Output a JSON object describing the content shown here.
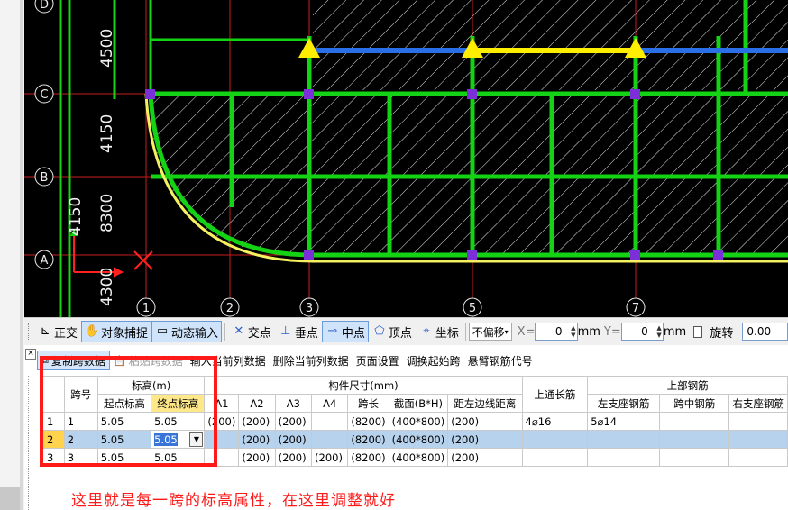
{
  "cad_view": {
    "axis_labels": [
      "D",
      "C",
      "B",
      "A",
      "1",
      "2",
      "3",
      "5",
      "7"
    ],
    "dimensions": [
      "4500",
      "4150",
      "8300",
      "4150",
      "4150",
      "4300"
    ]
  },
  "toolbar": {
    "items": [
      {
        "label": "正交",
        "icon": "ortho-icon"
      },
      {
        "label": "对象捕捉",
        "icon": "object-snap-icon"
      },
      {
        "label": "动态输入",
        "icon": "dynamic-input-icon"
      },
      {
        "label": "交点",
        "icon": "intersection-icon"
      },
      {
        "label": "垂点",
        "icon": "perpendicular-icon"
      },
      {
        "label": "中点",
        "icon": "midpoint-icon"
      },
      {
        "label": "顶点",
        "icon": "vertex-icon"
      },
      {
        "label": "坐标",
        "icon": "coordinate-icon"
      }
    ],
    "offset_select": "不偏移",
    "x_label": "X=",
    "x_value": "0",
    "y_label": "Y=",
    "y_value": "0",
    "unit": "mm",
    "rotate_label": "旋转",
    "rotate_value": "0.00"
  },
  "panel_toolbar": {
    "copy_span": "复制跨数据",
    "paste_span": "粘贴跨数据",
    "input": "输入当前列数据",
    "delete": "删除当前列数据",
    "page_setup": "页面设置",
    "swap": "调换起始跨",
    "cantilever": "悬臂钢筋代号"
  },
  "table": {
    "header": {
      "span_no": "跨号",
      "elevation": "标高(m)",
      "start_elev": "起点标高",
      "end_elev": "终点标高",
      "member_size": "构件尺寸(mm)",
      "a1": "A1",
      "a2": "A2",
      "a3": "A3",
      "a4": "A4",
      "span_len": "跨长",
      "section": "截面(B*H)",
      "left_dist": "距左边线距离",
      "top_long_bar": "上通长筋",
      "top_rebar": "上部钢筋",
      "left_support": "左支座钢筋",
      "mid_span": "跨中钢筋",
      "right_support": "右支座钢筋"
    },
    "rows": [
      {
        "rn": "1",
        "span": "1",
        "start": "5.05",
        "end": "5.05",
        "a1": "(200)",
        "a2": "(200)",
        "a3": "(200)",
        "a4": "",
        "len": "(8200)",
        "sec": "(400*800)",
        "dist": "(200)",
        "long": "4⌀16",
        "left": "5⌀14",
        "mid": "",
        "right": ""
      },
      {
        "rn": "2",
        "span": "2",
        "start": "5.05",
        "end": "5.05",
        "a1": "",
        "a2": "(200)",
        "a3": "(200)",
        "a4": "",
        "len": "(8200)",
        "sec": "(400*800)",
        "dist": "(200)",
        "long": "",
        "left": "",
        "mid": "",
        "right": ""
      },
      {
        "rn": "3",
        "span": "3",
        "start": "5.05",
        "end": "5.05",
        "a1": "",
        "a2": "(200)",
        "a3": "(200)",
        "a4": "(200)",
        "len": "(8200)",
        "sec": "(400*800)",
        "dist": "(200)",
        "long": "",
        "left": "",
        "mid": "",
        "right": ""
      }
    ]
  },
  "annotation": "这里就是每一跨的标高属性，在这里调整就好",
  "colors": {
    "highlight_box": "#ff1a1a",
    "annotation_text": "#ff1a1a",
    "selected_row": "#b7d2ec"
  }
}
